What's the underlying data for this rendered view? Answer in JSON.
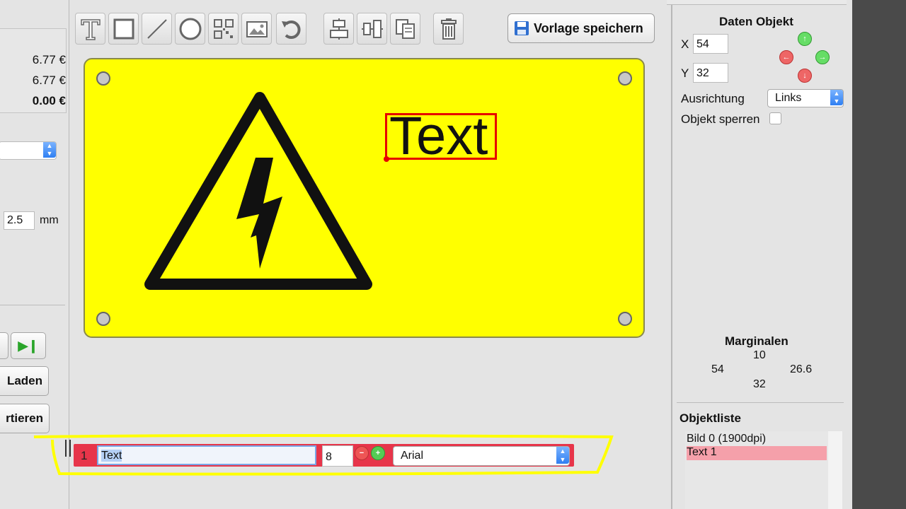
{
  "left_panel": {
    "price_1": "6.77 €",
    "price_2": "6.77 €",
    "price_total": "0.00 €",
    "thickness_value": "2.5",
    "thickness_unit": "mm",
    "load_label": "Laden",
    "export_label": "rtieren"
  },
  "toolbar": {
    "save_label": "Vorlage speichern"
  },
  "canvas": {
    "text_object": "Text"
  },
  "edit_row": {
    "index": "1",
    "text_value": "Text",
    "font_size": "8",
    "font": "Arial"
  },
  "right_panel": {
    "title": "Daten Objekt",
    "x_label": "X",
    "x_value": "54",
    "y_label": "Y",
    "y_value": "32",
    "alignment_label": "Ausrichtung",
    "alignment_value": "Links",
    "lock_label": "Objekt sperren",
    "margins_title": "Marginalen",
    "margin_top": "10",
    "margin_left": "54",
    "margin_right": "26.6",
    "margin_bottom": "32",
    "objects_title": "Objektliste",
    "objects": [
      {
        "label": "Bild 0 (1900dpi)"
      },
      {
        "label": "Text 1"
      }
    ]
  },
  "colors": {
    "sign_background": "#ffff00",
    "selection": "#e60000",
    "edit_row": "#e7354a",
    "highlight": "#f5a0aa"
  }
}
